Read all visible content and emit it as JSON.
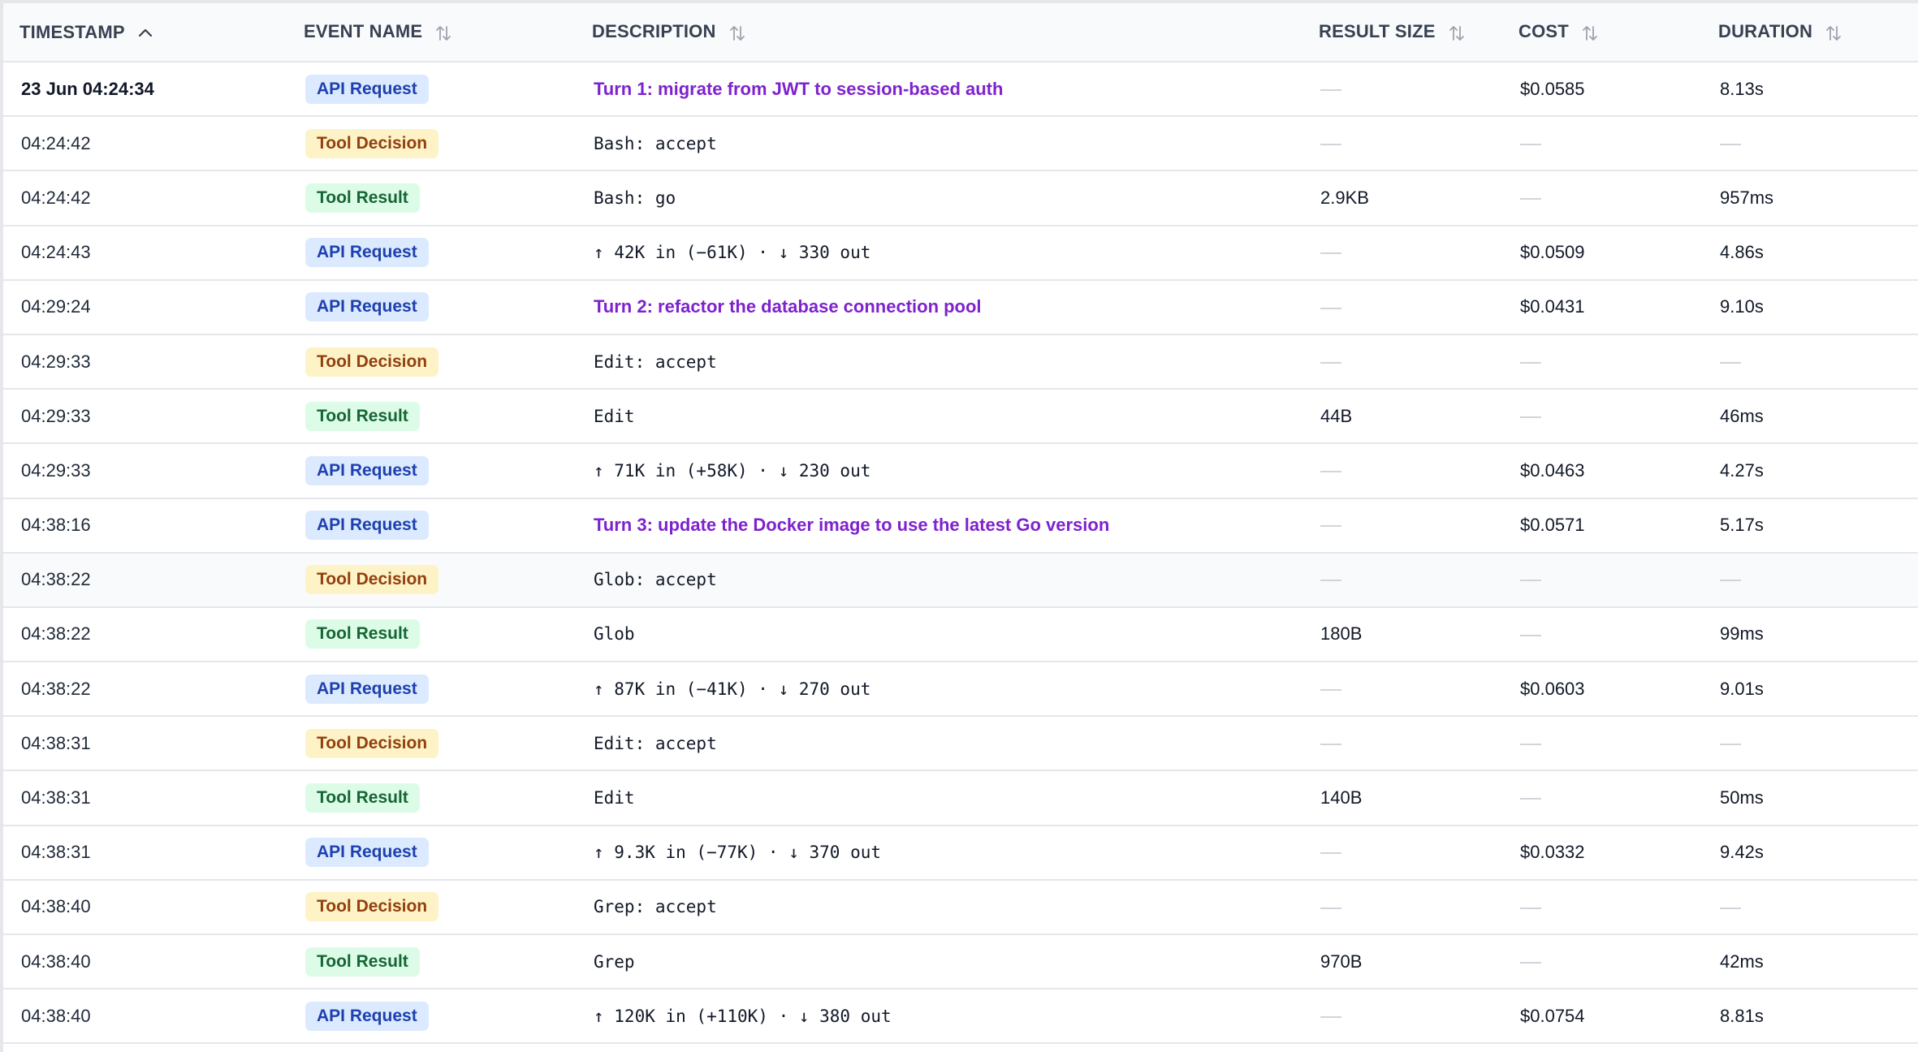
{
  "columns": {
    "timestamp": "TIMESTAMP",
    "event_name": "EVENT NAME",
    "description": "DESCRIPTION",
    "result_size": "RESULT SIZE",
    "cost": "COST",
    "duration": "DURATION"
  },
  "sort": {
    "column": "timestamp",
    "direction": "ascending"
  },
  "colors": {
    "api_request": "#dbeafe",
    "tool_decision": "#fef3c7",
    "tool_result": "#dcfce7",
    "turn_text": "#7e22ce"
  },
  "rows": [
    {
      "timestamp": "23 Jun 04:24:34",
      "event": "API Request",
      "type": "api",
      "description": "Turn 1: migrate from JWT to session-based auth",
      "desc_style": "turn",
      "result_size": "",
      "cost": "$0.0585",
      "duration": "8.13s"
    },
    {
      "timestamp": "04:24:42",
      "event": "Tool Decision",
      "type": "dec",
      "description": "Bash: accept",
      "desc_style": "mono",
      "result_size": "",
      "cost": "",
      "duration": ""
    },
    {
      "timestamp": "04:24:42",
      "event": "Tool Result",
      "type": "res",
      "description": "Bash: go",
      "desc_style": "mono",
      "result_size": "2.9KB",
      "cost": "",
      "duration": "957ms"
    },
    {
      "timestamp": "04:24:43",
      "event": "API Request",
      "type": "api",
      "description": "↑ 42K in (−61K) · ↓ 330 out",
      "desc_style": "mono",
      "result_size": "",
      "cost": "$0.0509",
      "duration": "4.86s"
    },
    {
      "timestamp": "04:29:24",
      "event": "API Request",
      "type": "api",
      "description": "Turn 2: refactor the database connection pool",
      "desc_style": "turn",
      "result_size": "",
      "cost": "$0.0431",
      "duration": "9.10s"
    },
    {
      "timestamp": "04:29:33",
      "event": "Tool Decision",
      "type": "dec",
      "description": "Edit: accept",
      "desc_style": "mono",
      "result_size": "",
      "cost": "",
      "duration": ""
    },
    {
      "timestamp": "04:29:33",
      "event": "Tool Result",
      "type": "res",
      "description": "Edit",
      "desc_style": "mono",
      "result_size": "44B",
      "cost": "",
      "duration": "46ms"
    },
    {
      "timestamp": "04:29:33",
      "event": "API Request",
      "type": "api",
      "description": "↑ 71K in (+58K) · ↓ 230 out",
      "desc_style": "mono",
      "result_size": "",
      "cost": "$0.0463",
      "duration": "4.27s"
    },
    {
      "timestamp": "04:38:16",
      "event": "API Request",
      "type": "api",
      "description": "Turn 3: update the Docker image to use the latest Go version",
      "desc_style": "turn",
      "result_size": "",
      "cost": "$0.0571",
      "duration": "5.17s"
    },
    {
      "timestamp": "04:38:22",
      "event": "Tool Decision",
      "type": "dec",
      "description": "Glob: accept",
      "desc_style": "mono",
      "result_size": "",
      "cost": "",
      "duration": "",
      "highlighted": true
    },
    {
      "timestamp": "04:38:22",
      "event": "Tool Result",
      "type": "res",
      "description": "Glob",
      "desc_style": "mono",
      "result_size": "180B",
      "cost": "",
      "duration": "99ms"
    },
    {
      "timestamp": "04:38:22",
      "event": "API Request",
      "type": "api",
      "description": "↑ 87K in (−41K) · ↓ 270 out",
      "desc_style": "mono",
      "result_size": "",
      "cost": "$0.0603",
      "duration": "9.01s"
    },
    {
      "timestamp": "04:38:31",
      "event": "Tool Decision",
      "type": "dec",
      "description": "Edit: accept",
      "desc_style": "mono",
      "result_size": "",
      "cost": "",
      "duration": ""
    },
    {
      "timestamp": "04:38:31",
      "event": "Tool Result",
      "type": "res",
      "description": "Edit",
      "desc_style": "mono",
      "result_size": "140B",
      "cost": "",
      "duration": "50ms"
    },
    {
      "timestamp": "04:38:31",
      "event": "API Request",
      "type": "api",
      "description": "↑ 9.3K in (−77K) · ↓ 370 out",
      "desc_style": "mono",
      "result_size": "",
      "cost": "$0.0332",
      "duration": "9.42s"
    },
    {
      "timestamp": "04:38:40",
      "event": "Tool Decision",
      "type": "dec",
      "description": "Grep: accept",
      "desc_style": "mono",
      "result_size": "",
      "cost": "",
      "duration": ""
    },
    {
      "timestamp": "04:38:40",
      "event": "Tool Result",
      "type": "res",
      "description": "Grep",
      "desc_style": "mono",
      "result_size": "970B",
      "cost": "",
      "duration": "42ms"
    },
    {
      "timestamp": "04:38:40",
      "event": "API Request",
      "type": "api",
      "description": "↑ 120K in (+110K) · ↓ 380 out",
      "desc_style": "mono",
      "result_size": "",
      "cost": "$0.0754",
      "duration": "8.81s"
    }
  ]
}
